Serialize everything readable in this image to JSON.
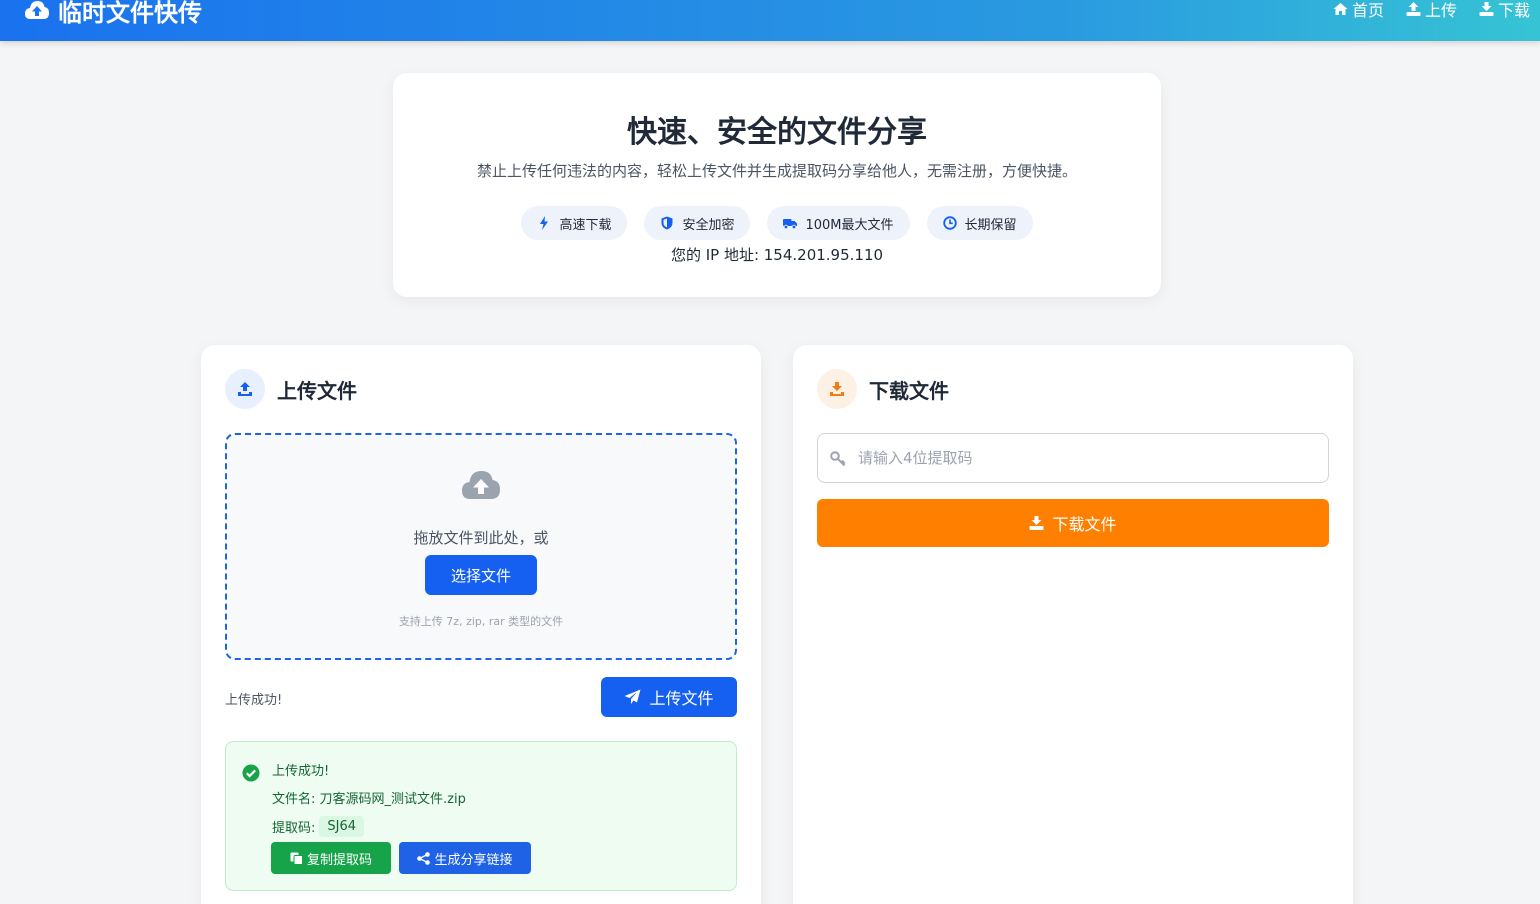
{
  "header": {
    "title": "临时文件快传",
    "nav": [
      {
        "label": "首页",
        "icon": "home-icon"
      },
      {
        "label": "上传",
        "icon": "upload-icon"
      },
      {
        "label": "下载",
        "icon": "download-icon"
      }
    ]
  },
  "hero": {
    "title": "快速、安全的文件分享",
    "description": "禁止上传任何违法的内容，轻松上传文件并生成提取码分享给他人，无需注册，方便快捷。",
    "features": [
      {
        "label": "高速下载",
        "icon": "bolt-icon"
      },
      {
        "label": "安全加密",
        "icon": "shield-icon"
      },
      {
        "label": "100M最大文件",
        "icon": "truck-icon"
      },
      {
        "label": "长期保留",
        "icon": "clock-icon"
      }
    ],
    "ip_text": "您的 IP 地址: 154.201.95.110"
  },
  "upload": {
    "title": "上传文件",
    "drop_text": "拖放文件到此处，或",
    "choose_label": "选择文件",
    "hint": "支持上传 7z, zip, rar 类型的文件",
    "status": "上传成功!",
    "upload_button": "上传文件",
    "result": {
      "title": "上传成功!",
      "filename_text": "文件名: 刀客源码网_测试文件.zip",
      "code_label": "提取码:",
      "code": "SJ64",
      "copy_label": "复制提取码",
      "share_label": "生成分享链接"
    }
  },
  "download": {
    "title": "下载文件",
    "placeholder": "请输入4位提取码",
    "button": "下载文件"
  },
  "colors": {
    "primary": "#1560f0",
    "accent": "#ff7f00",
    "success": "#16a34a"
  }
}
